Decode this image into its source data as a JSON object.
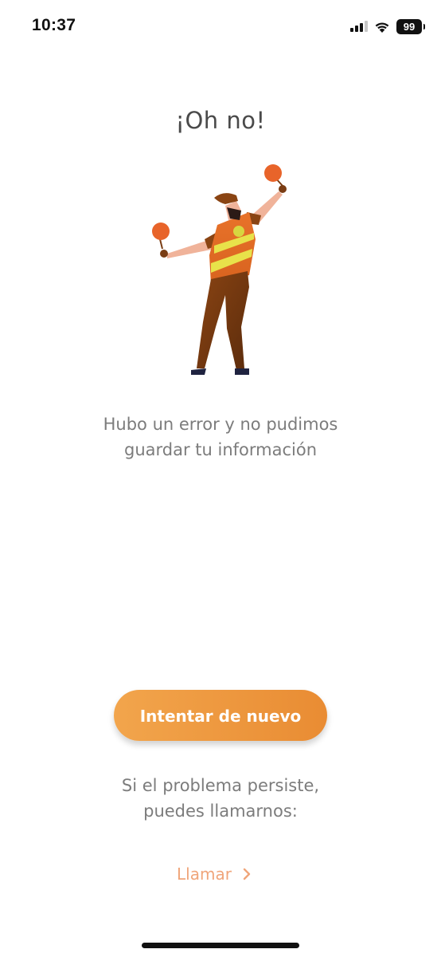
{
  "status_bar": {
    "time": "10:37",
    "battery": "99",
    "icons": [
      "signal-icon",
      "wifi-icon",
      "battery-icon"
    ]
  },
  "screen": {
    "title": "¡Oh no!",
    "illustration": "traffic-worker-illustration",
    "message_line1": "Hubo un error y no pudimos",
    "message_line2": "guardar tu información",
    "retry_label": "Intentar de nuevo",
    "persist_line1": "Si el problema persiste,",
    "persist_line2": "puedes llamarnos:",
    "call_label": "Llamar"
  },
  "colors": {
    "accent_orange": "#ec9238",
    "link_orange": "#f0a57a",
    "text_gray": "#7c7c7c",
    "title_gray": "#4a4a4a"
  }
}
